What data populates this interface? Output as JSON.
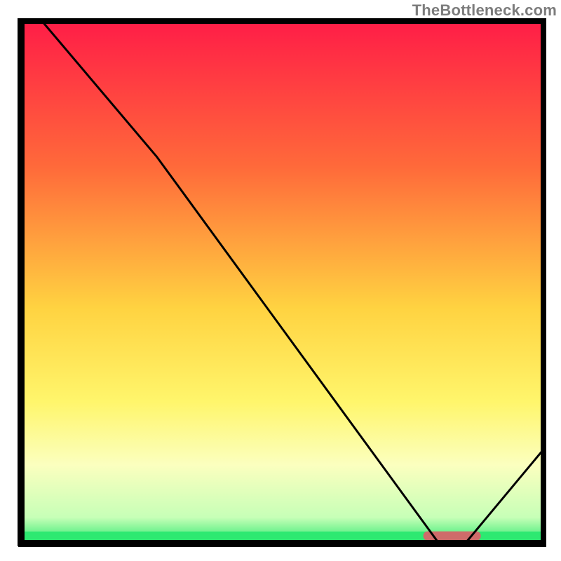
{
  "watermark": "TheBottleneck.com",
  "chart_data": {
    "type": "line",
    "title": "",
    "xlabel": "",
    "ylabel": "",
    "xlim": [
      0,
      100
    ],
    "ylim": [
      0,
      100
    ],
    "x": [
      4,
      26,
      80,
      85,
      100
    ],
    "values": [
      100,
      74,
      0,
      0,
      18
    ],
    "green_band_y": [
      0,
      2.5
    ],
    "marker": {
      "x_range": [
        77,
        88
      ],
      "y": 1.5,
      "color": "#cf6b6a"
    },
    "gradient_stops": [
      {
        "pos": 0,
        "color": "#ff1d47"
      },
      {
        "pos": 28,
        "color": "#ff6a3a"
      },
      {
        "pos": 55,
        "color": "#ffd341"
      },
      {
        "pos": 73,
        "color": "#fff66c"
      },
      {
        "pos": 85,
        "color": "#fbffbf"
      },
      {
        "pos": 95,
        "color": "#c7ffb7"
      },
      {
        "pos": 100,
        "color": "#29e86f"
      }
    ]
  }
}
